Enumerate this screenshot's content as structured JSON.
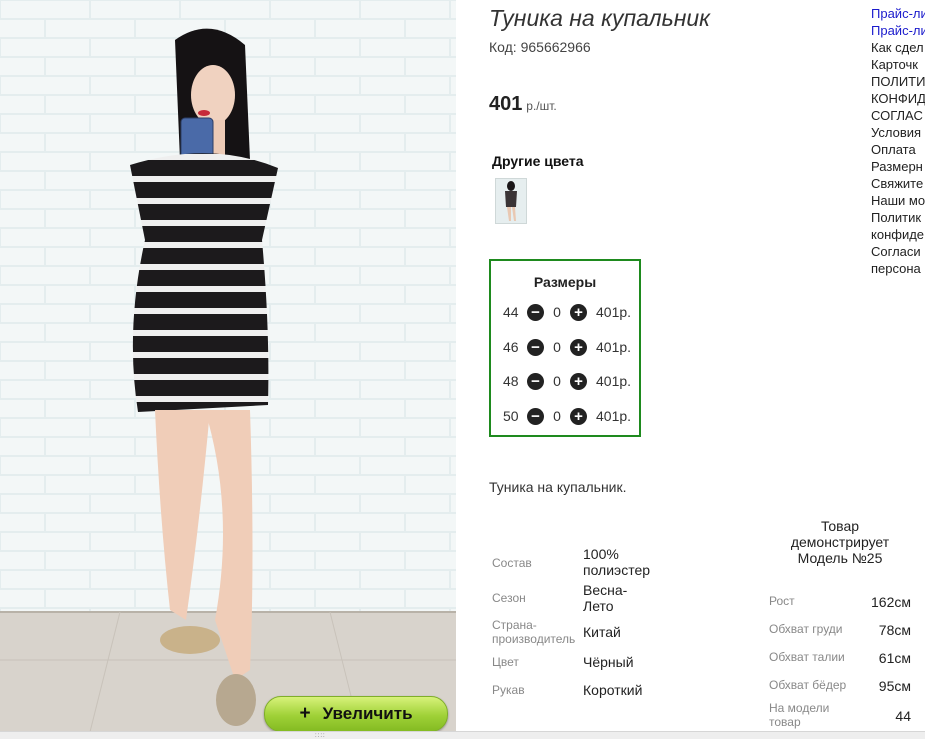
{
  "product": {
    "title": "Туника на купальник",
    "code": "Код: 965662966",
    "price_value": "401",
    "price_unit": "р./шт.",
    "other_colors_title": "Другие цвета",
    "description": "Туника на купальник.",
    "zoom_label": "Увеличить",
    "zoom_icon": "+"
  },
  "sizes": {
    "title": "Размеры",
    "minus_icon": "−",
    "plus_icon": "+",
    "rows": [
      {
        "size": "44",
        "qty": "0",
        "price": "401р."
      },
      {
        "size": "46",
        "qty": "0",
        "price": "401р."
      },
      {
        "size": "48",
        "qty": "0",
        "price": "401р."
      },
      {
        "size": "50",
        "qty": "0",
        "price": "401р."
      }
    ]
  },
  "specs": [
    {
      "label": "Состав",
      "value": "100% полиэстер"
    },
    {
      "label": "Сезон",
      "value": "Весна-Лето"
    },
    {
      "label": "Страна-производитель",
      "value": "Китай"
    },
    {
      "label": "Цвет",
      "value": "Чёрный"
    },
    {
      "label": "Рукав",
      "value": "Короткий"
    }
  ],
  "model": {
    "heading": "Товар демонстрирует Модель №25",
    "params": [
      {
        "label": "Рост",
        "value": "162см"
      },
      {
        "label": "Обхват груди",
        "value": "78см"
      },
      {
        "label": "Обхват талии",
        "value": "61см"
      },
      {
        "label": "Обхват бёдер",
        "value": "95см"
      },
      {
        "label": "На модели товар",
        "value": "44"
      }
    ]
  },
  "side_links": [
    "Прайс-ли",
    "Прайс-ли",
    "Как сдел",
    "Карточк",
    "ПОЛИТИ",
    "КОНФИД",
    "СОГЛАС",
    "Условия",
    "Оплата",
    "Размерн",
    "Свяжите",
    "Наши мо",
    "Политик",
    "конфиде",
    "Согласи",
    "персона"
  ],
  "bottom_grip": "::::",
  "colors": {
    "size_box_border": "#1e8a1e",
    "link": "#1a1acc",
    "zoom_button": "#9fd137"
  }
}
